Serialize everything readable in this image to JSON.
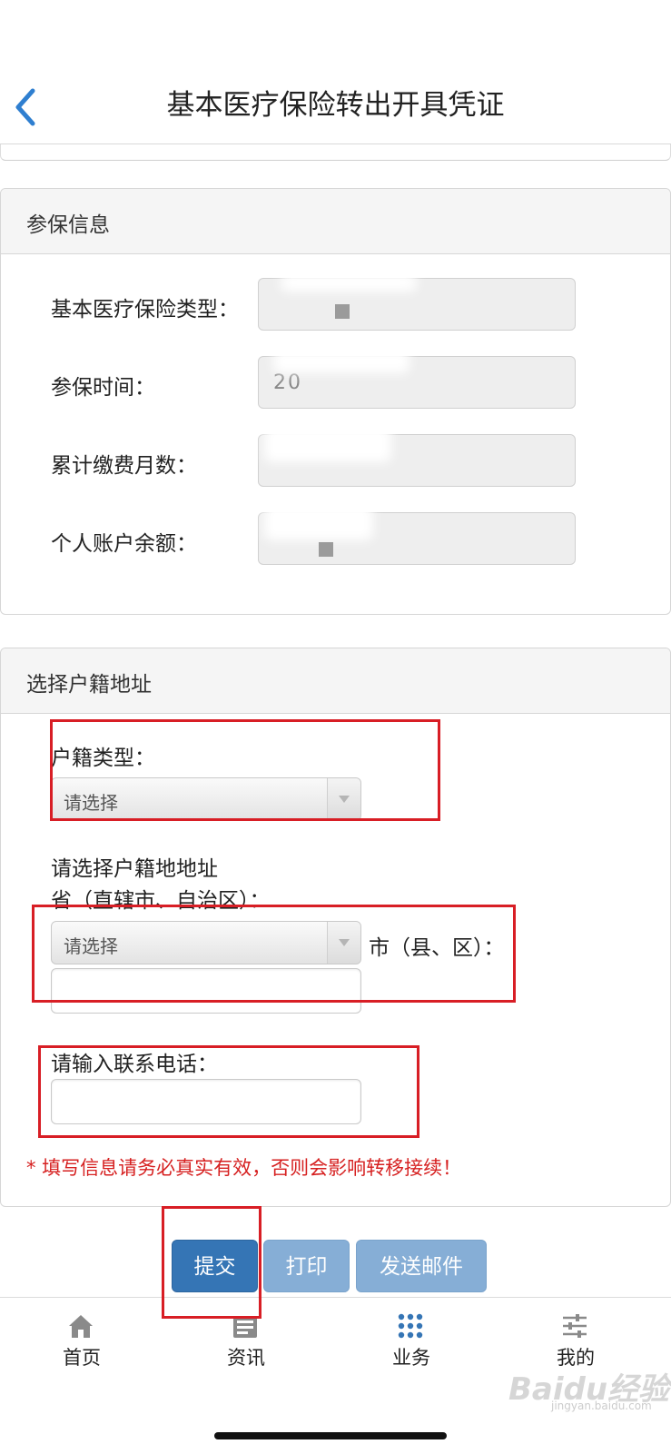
{
  "header": {
    "title": "基本医疗保险转出开具凭证"
  },
  "insurance": {
    "section_title": "参保信息",
    "fields": [
      {
        "label": "基本医疗保险类型："
      },
      {
        "label": "参保时间：",
        "value_partial": "20"
      },
      {
        "label": "累计缴费月数："
      },
      {
        "label": "个人账户余额："
      }
    ]
  },
  "address": {
    "section_title": "选择户籍地址",
    "hukou_type_label": "户籍类型：",
    "hukou_type_placeholder": "请选择",
    "address_prompt": "请选择户籍地地址",
    "province_label": "省（直辖市、自治区）：",
    "province_placeholder": "请选择",
    "city_label": "市（县、区）：",
    "city_value": "",
    "phone_label": "请输入联系电话：",
    "phone_value": "",
    "warning": "* 填写信息请务必真实有效，否则会影响转移接续！"
  },
  "actions": {
    "submit": "提交",
    "print": "打印",
    "email": "发送邮件"
  },
  "tabbar": {
    "items": [
      {
        "label": "首页",
        "icon": "home-icon"
      },
      {
        "label": "资讯",
        "icon": "news-icon"
      },
      {
        "label": "业务",
        "icon": "grid-icon"
      },
      {
        "label": "我的",
        "icon": "settings-sliders-icon"
      }
    ]
  },
  "watermark": {
    "text": "Baidu经验",
    "url": "jingyan.baidu.com"
  },
  "colors": {
    "accent": "#3575b5",
    "accent_light": "#86aed6",
    "warning": "#d62020",
    "highlight_box": "#d81e25"
  }
}
